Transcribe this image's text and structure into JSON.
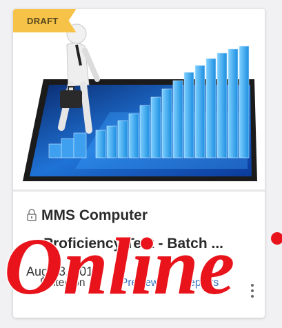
{
  "card": {
    "badge": "DRAFT",
    "title_line1": "MMS Computer",
    "title_line2": "Proficiency Test - Batch ...",
    "date": "Aug 23, 2019",
    "edited_label": "Edited on",
    "preview_label": "Preview",
    "reports_label": "Reports",
    "icons": [
      "lock-icon",
      "more-vertical-icon"
    ]
  },
  "overlay": {
    "text": "Online",
    "color": "#e8131b"
  }
}
